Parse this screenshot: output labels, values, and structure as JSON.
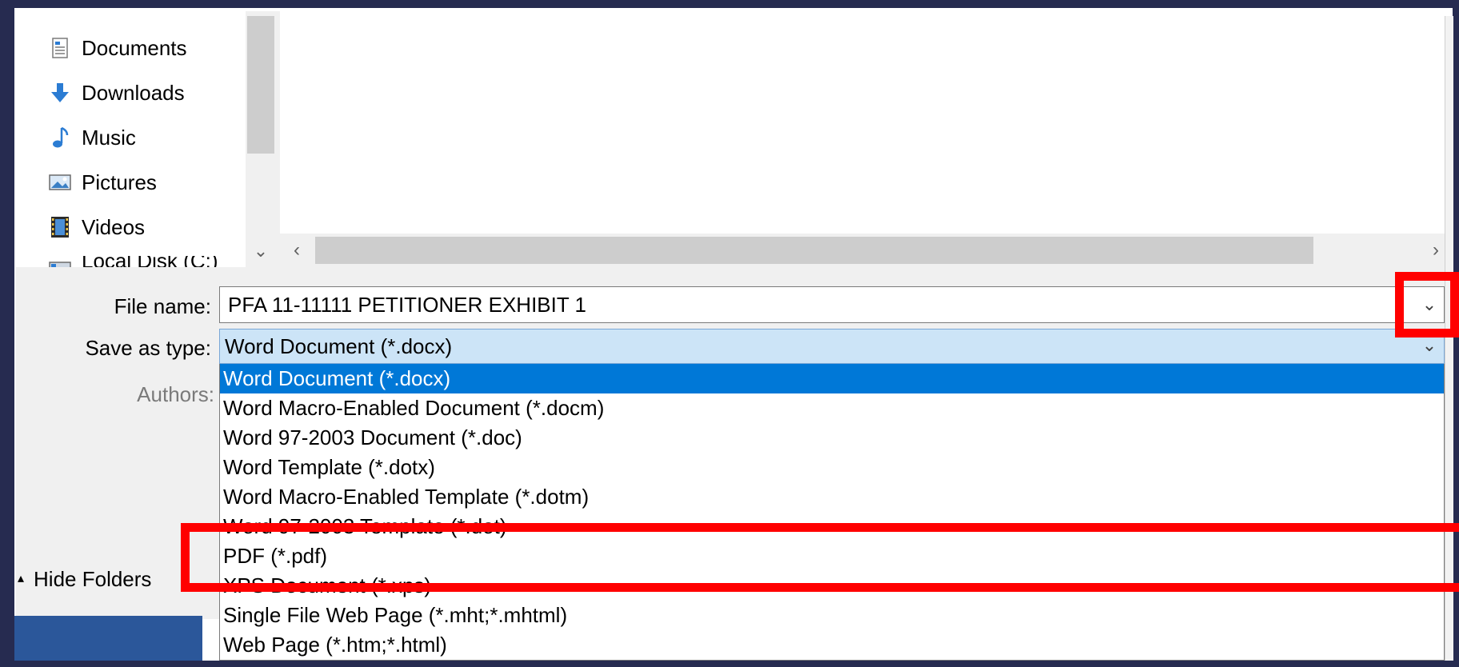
{
  "navigation": {
    "items": [
      {
        "label": "Documents",
        "icon": "documents-icon"
      },
      {
        "label": "Downloads",
        "icon": "downloads-icon"
      },
      {
        "label": "Music",
        "icon": "music-icon"
      },
      {
        "label": "Pictures",
        "icon": "pictures-icon"
      },
      {
        "label": "Videos",
        "icon": "videos-icon"
      },
      {
        "label": "Local Disk (C:)",
        "icon": "drive-icon"
      }
    ]
  },
  "form": {
    "file_name_label": "File name:",
    "file_name_value": "PFA 11-11111 PETITIONER EXHIBIT 1",
    "save_as_type_label": "Save as type:",
    "save_as_type_value": "Word Document (*.docx)",
    "authors_label": "Authors:"
  },
  "save_type_options": [
    "Word Document (*.docx)",
    "Word Macro-Enabled Document (*.docm)",
    "Word 97-2003 Document (*.doc)",
    "Word Template (*.dotx)",
    "Word Macro-Enabled Template (*.dotm)",
    "Word 97-2003 Template (*.dot)",
    "PDF (*.pdf)",
    "XPS Document (*.xps)",
    "Single File Web Page (*.mht;*.mhtml)",
    "Web Page (*.htm;*.html)"
  ],
  "selected_option_index": 0,
  "hide_folders_label": "Hide Folders",
  "colors": {
    "highlight": "#0078d7",
    "annotation": "#ff0000",
    "frame": "#262b50"
  }
}
